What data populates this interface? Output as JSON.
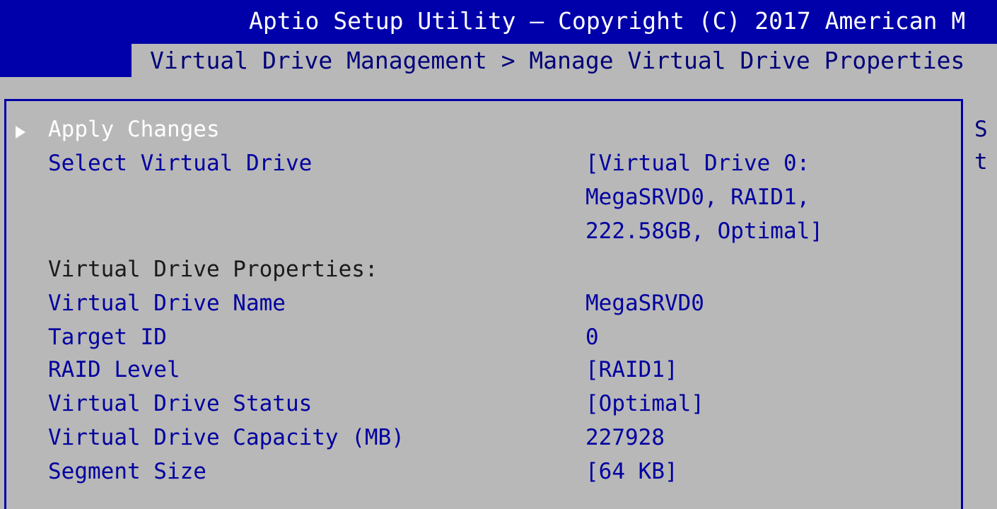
{
  "header": {
    "title": "Aptio Setup Utility – Copyright (C) 2017 American M",
    "breadcrumb": "Virtual Drive Management > Manage Virtual Drive Properties"
  },
  "help_panel": {
    "line1": "S",
    "line2": "t"
  },
  "menu": {
    "apply_changes": "Apply Changes",
    "select_vd_label": "Select Virtual Drive",
    "select_vd_value_line1": "[Virtual Drive 0:",
    "select_vd_value_line2": "MegaSRVD0, RAID1,",
    "select_vd_value_line3": "222.58GB, Optimal]",
    "properties_heading": "Virtual Drive Properties:",
    "rows": [
      {
        "label": "Virtual Drive Name",
        "value": "MegaSRVD0"
      },
      {
        "label": "Target ID",
        "value": "0"
      },
      {
        "label": "RAID Level",
        "value": "[RAID1]"
      },
      {
        "label": "Virtual Drive Status",
        "value": "[Optimal]"
      },
      {
        "label": "Virtual Drive Capacity (MB)",
        "value": "227928"
      },
      {
        "label": "Segment Size",
        "value": "[64 KB]"
      }
    ]
  },
  "colors": {
    "background": "#b8b8b8",
    "header_blue": "#0000aa",
    "item_blue": "#0000a0",
    "selected_white": "#ffffff"
  }
}
